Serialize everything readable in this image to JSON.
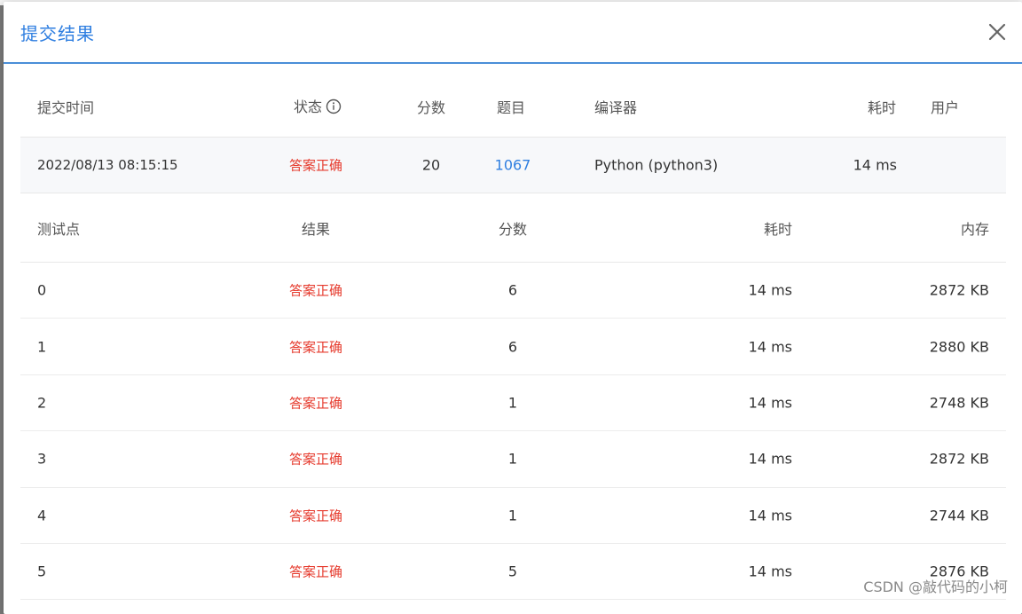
{
  "modal": {
    "title": "提交结果"
  },
  "summary": {
    "headers": {
      "time": "提交时间",
      "status": "状态",
      "score": "分数",
      "problem": "题目",
      "compiler": "编译器",
      "duration": "耗时",
      "user": "用户"
    },
    "row": {
      "time": "2022/08/13 08:15:15",
      "status": "答案正确",
      "score": "20",
      "problem": "1067",
      "compiler": "Python (python3)",
      "duration": "14 ms",
      "user": ""
    }
  },
  "details": {
    "headers": {
      "case": "测试点",
      "result": "结果",
      "score": "分数",
      "duration": "耗时",
      "memory": "内存"
    },
    "rows": [
      {
        "case": "0",
        "result": "答案正确",
        "score": "6",
        "duration": "14 ms",
        "memory": "2872 KB"
      },
      {
        "case": "1",
        "result": "答案正确",
        "score": "6",
        "duration": "14 ms",
        "memory": "2880 KB"
      },
      {
        "case": "2",
        "result": "答案正确",
        "score": "1",
        "duration": "14 ms",
        "memory": "2748 KB"
      },
      {
        "case": "3",
        "result": "答案正确",
        "score": "1",
        "duration": "14 ms",
        "memory": "2872 KB"
      },
      {
        "case": "4",
        "result": "答案正确",
        "score": "1",
        "duration": "14 ms",
        "memory": "2744 KB"
      },
      {
        "case": "5",
        "result": "答案正确",
        "score": "5",
        "duration": "14 ms",
        "memory": "2876 KB"
      }
    ]
  },
  "watermark": "CSDN @敲代码的小柯",
  "colors": {
    "accent": "#2e7ee0",
    "status_ok": "#e63b2e"
  },
  "icons": {
    "close": "close-icon",
    "info": "info-icon"
  }
}
